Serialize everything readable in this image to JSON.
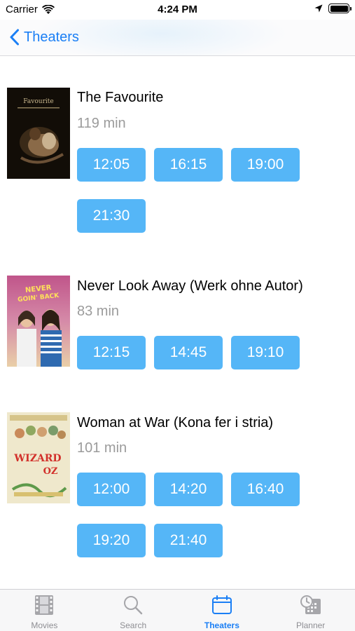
{
  "status_bar": {
    "carrier": "Carrier",
    "time": "4:24 PM"
  },
  "nav": {
    "back_label": "Theaters"
  },
  "movies": [
    {
      "title": "The Favourite",
      "duration": "119 min",
      "poster_text": "Favourite",
      "times": [
        "12:05",
        "16:15",
        "19:00",
        "21:30"
      ]
    },
    {
      "title": "Never Look Away (Werk ohne Autor)",
      "duration": "83 min",
      "poster_text": "NEVER GOIN' BACK",
      "times": [
        "12:15",
        "14:45",
        "19:10"
      ]
    },
    {
      "title": "Woman at War (Kona fer i stria)",
      "duration": "101 min",
      "poster_text": "WIZARD OF OZ",
      "times": [
        "12:00",
        "14:20",
        "16:40",
        "19:20",
        "21:40"
      ]
    }
  ],
  "tabs": [
    {
      "label": "Movies",
      "icon": "film-icon",
      "active": false
    },
    {
      "label": "Search",
      "icon": "search-icon",
      "active": false
    },
    {
      "label": "Theaters",
      "icon": "calendar-icon",
      "active": true
    },
    {
      "label": "Planner",
      "icon": "planner-icon",
      "active": false
    }
  ],
  "colors": {
    "accent": "#1b7ff5",
    "time_button": "#55b6f7",
    "duration_text": "#9b9b9b"
  }
}
